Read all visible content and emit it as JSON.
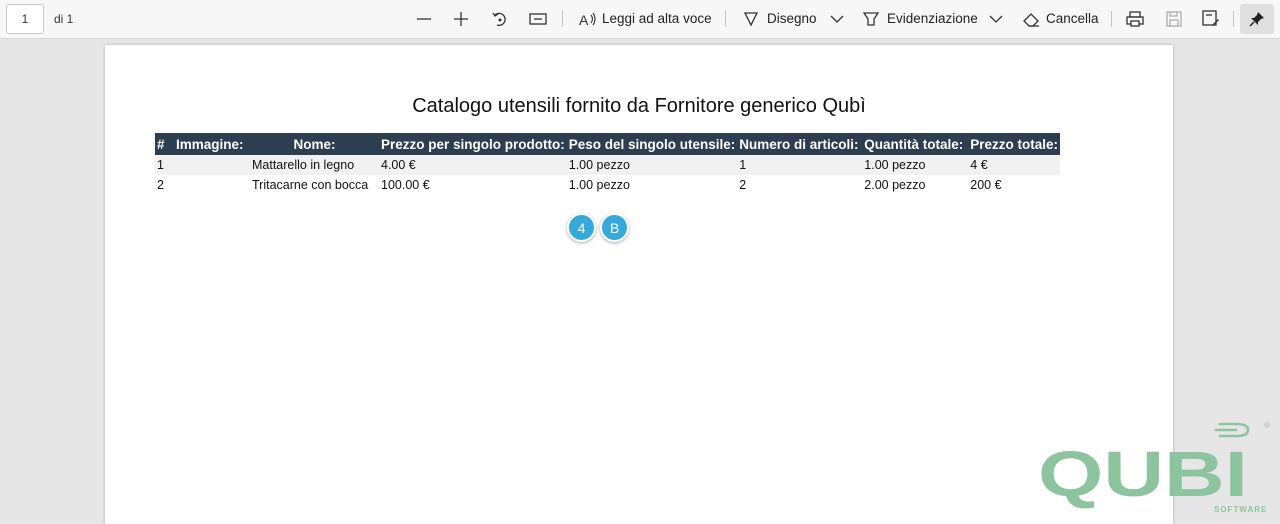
{
  "toolbar": {
    "page_current": "1",
    "page_of": "di 1",
    "read_aloud_label": "Leggi ad alta voce",
    "draw_label": "Disegno",
    "highlight_label": "Evidenziazione",
    "erase_label": "Cancella"
  },
  "document": {
    "title": "Catalogo utensili fornito da Fornitore generico Qubì",
    "columns": [
      "#",
      "Immagine:",
      "Nome:",
      "Prezzo per singolo prodotto:",
      "Peso del singolo utensile:",
      "Numero di articoli:",
      "Quantità totale:",
      "Prezzo totale:"
    ],
    "rows": [
      [
        "1",
        "",
        "Mattarello in legno",
        "4.00 €",
        "1.00 pezzo",
        "1",
        "1.00 pezzo",
        "4 €"
      ],
      [
        "2",
        "",
        "Tritacarne con bocca",
        "100.00 €",
        "1.00 pezzo",
        "2",
        "2.00 pezzo",
        "200 €"
      ]
    ],
    "badges": [
      "4",
      "B"
    ]
  },
  "logo": {
    "text": "QUBI",
    "tagline": "SOFTWARE",
    "registered": "®",
    "color": "#8cc49e"
  }
}
